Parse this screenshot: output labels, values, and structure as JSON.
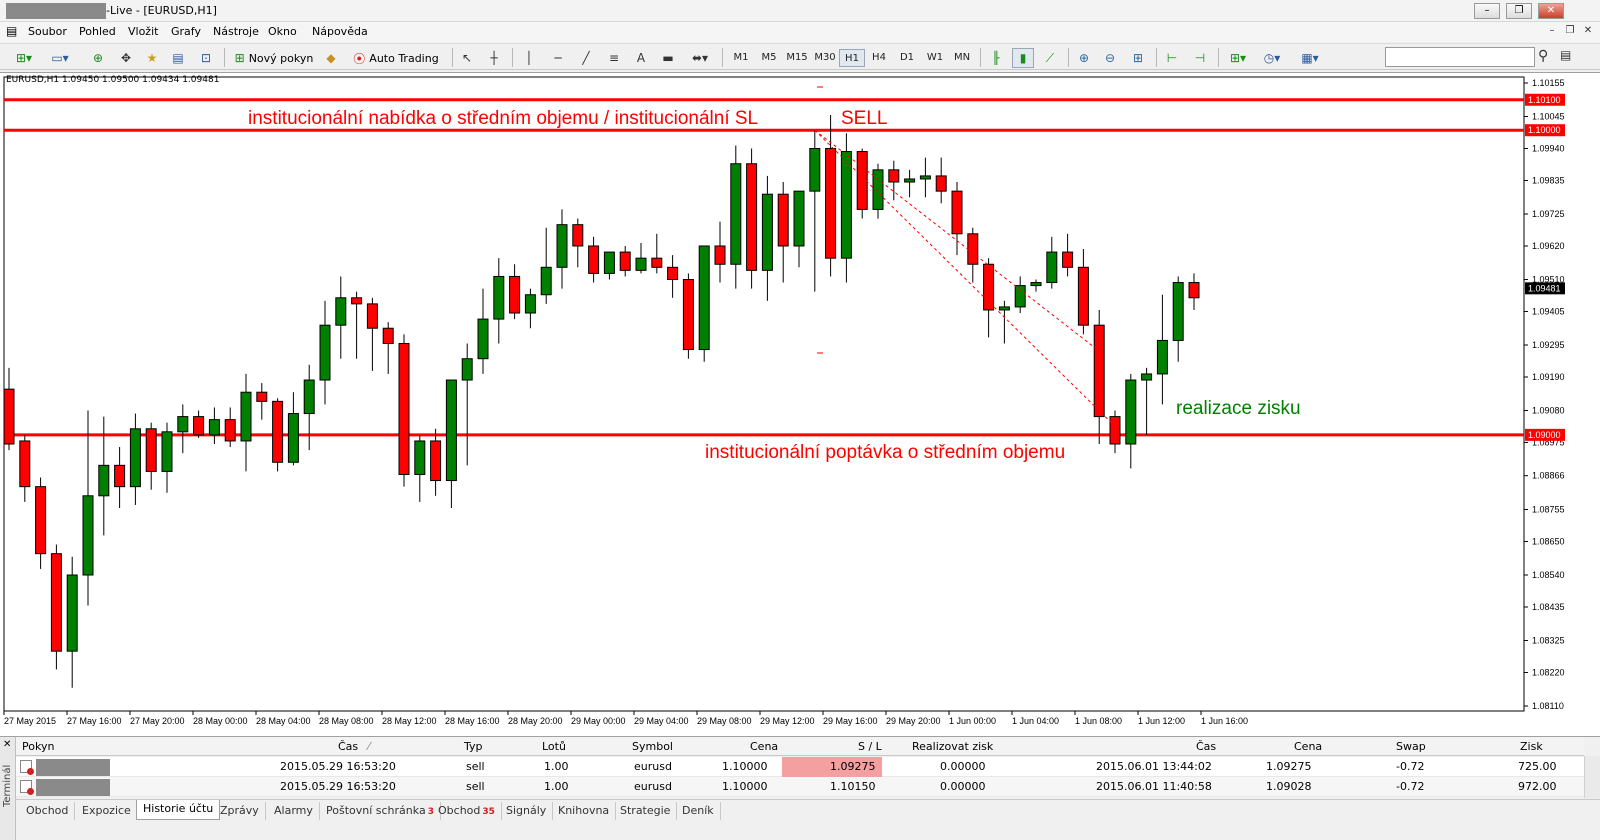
{
  "window": {
    "title": "-Live - [EURUSD,H1]",
    "controls": [
      "–",
      "❐",
      "✕"
    ]
  },
  "menu": {
    "items": [
      "Soubor",
      "Pohled",
      "Vložit",
      "Grafy",
      "Nástroje",
      "Okno",
      "Nápověda"
    ],
    "mdi_controls": [
      "–",
      "❐",
      "✕"
    ]
  },
  "toolbar": {
    "new_order_label": "Nový pokyn",
    "auto_trading_label": "Auto Trading",
    "text_tool_label": "A",
    "timeframes": [
      "M1",
      "M5",
      "M15",
      "M30",
      "H1",
      "H4",
      "D1",
      "W1",
      "MN"
    ],
    "active_timeframe": "H1",
    "search_placeholder": ""
  },
  "chart": {
    "header": "EURUSD,H1  1.09450 1.09500 1.09434 1.09481",
    "price_labels": [
      "1.10155",
      "1.10045",
      "1.09940",
      "1.09835",
      "1.09725",
      "1.09620",
      "1.09510",
      "1.09405",
      "1.09295",
      "1.09190",
      "1.09080",
      "1.08975",
      "1.08866",
      "1.08755",
      "1.08650",
      "1.08540",
      "1.08435",
      "1.08325",
      "1.08220",
      "1.08110"
    ],
    "price_axis_range": [
      1.0811,
      1.10155
    ],
    "line_tags": [
      "1.10100",
      "1.10000",
      "1.09000"
    ],
    "current_price_tag": "1.09481",
    "time_labels": [
      "27 May 2015",
      "27 May 16:00",
      "27 May 20:00",
      "28 May 00:00",
      "28 May 04:00",
      "28 May 08:00",
      "28 May 12:00",
      "28 May 16:00",
      "28 May 20:00",
      "29 May 00:00",
      "29 May 04:00",
      "29 May 08:00",
      "29 May 12:00",
      "29 May 16:00",
      "29 May 20:00",
      "1 Jun 00:00",
      "1 Jun 04:00",
      "1 Jun 08:00",
      "1 Jun 12:00",
      "1 Jun 16:00"
    ],
    "annotations": {
      "supply_zone": "institucionální nabídka o středním objemu / institucionální SL",
      "sell": "SELL",
      "demand_zone": "institucionální poptávka o středním objemu",
      "take_profit": "realizace zisku"
    },
    "colors": {
      "bull": "#008000",
      "bear": "#ff0000",
      "level_line": "#ff0000",
      "text_red": "#ff0000",
      "text_green": "#008000"
    }
  },
  "chart_data": {
    "type": "candlestick",
    "symbol": "EURUSD",
    "timeframe": "H1",
    "ylim": [
      1.0811,
      1.10155
    ],
    "horizontal_levels": [
      1.101,
      1.1,
      1.09
    ],
    "candles": [
      {
        "o": 1.0915,
        "h": 1.0922,
        "l": 1.0895,
        "c": 1.0897
      },
      {
        "o": 1.0898,
        "h": 1.09,
        "l": 1.0878,
        "c": 1.0883
      },
      {
        "o": 1.0883,
        "h": 1.0886,
        "l": 1.0856,
        "c": 1.0861
      },
      {
        "o": 1.0861,
        "h": 1.0864,
        "l": 1.0823,
        "c": 1.0829
      },
      {
        "o": 1.0829,
        "h": 1.086,
        "l": 1.0817,
        "c": 1.0854
      },
      {
        "o": 1.0854,
        "h": 1.0908,
        "l": 1.0844,
        "c": 1.088
      },
      {
        "o": 1.088,
        "h": 1.0906,
        "l": 1.0867,
        "c": 1.089
      },
      {
        "o": 1.089,
        "h": 1.0896,
        "l": 1.0876,
        "c": 1.0883
      },
      {
        "o": 1.0883,
        "h": 1.0907,
        "l": 1.0877,
        "c": 1.0902
      },
      {
        "o": 1.0902,
        "h": 1.0904,
        "l": 1.0882,
        "c": 1.0888
      },
      {
        "o": 1.0888,
        "h": 1.0904,
        "l": 1.0881,
        "c": 1.0901
      },
      {
        "o": 1.0901,
        "h": 1.091,
        "l": 1.0894,
        "c": 1.0906
      },
      {
        "o": 1.0906,
        "h": 1.0908,
        "l": 1.0899,
        "c": 1.09
      },
      {
        "o": 1.09,
        "h": 1.0909,
        "l": 1.0897,
        "c": 1.0905
      },
      {
        "o": 1.0905,
        "h": 1.0909,
        "l": 1.0896,
        "c": 1.0898
      },
      {
        "o": 1.0898,
        "h": 1.092,
        "l": 1.0888,
        "c": 1.0914
      },
      {
        "o": 1.0914,
        "h": 1.0917,
        "l": 1.0905,
        "c": 1.0911
      },
      {
        "o": 1.0911,
        "h": 1.0912,
        "l": 1.0888,
        "c": 1.0891
      },
      {
        "o": 1.0891,
        "h": 1.0914,
        "l": 1.089,
        "c": 1.0907
      },
      {
        "o": 1.0907,
        "h": 1.0923,
        "l": 1.0895,
        "c": 1.0918
      },
      {
        "o": 1.0918,
        "h": 1.0944,
        "l": 1.091,
        "c": 1.0936
      },
      {
        "o": 1.0936,
        "h": 1.0952,
        "l": 1.0925,
        "c": 1.0945
      },
      {
        "o": 1.0945,
        "h": 1.0947,
        "l": 1.0925,
        "c": 1.0943
      },
      {
        "o": 1.0943,
        "h": 1.0945,
        "l": 1.0921,
        "c": 1.0935
      },
      {
        "o": 1.0935,
        "h": 1.0937,
        "l": 1.092,
        "c": 1.093
      },
      {
        "o": 1.093,
        "h": 1.0933,
        "l": 1.0883,
        "c": 1.0887
      },
      {
        "o": 1.0887,
        "h": 1.09,
        "l": 1.0878,
        "c": 1.0898
      },
      {
        "o": 1.0898,
        "h": 1.0902,
        "l": 1.088,
        "c": 1.0885
      },
      {
        "o": 1.0885,
        "h": 1.0915,
        "l": 1.0876,
        "c": 1.0918
      },
      {
        "o": 1.0918,
        "h": 1.093,
        "l": 1.089,
        "c": 1.0925
      },
      {
        "o": 1.0925,
        "h": 1.0948,
        "l": 1.092,
        "c": 1.0938
      },
      {
        "o": 1.0938,
        "h": 1.0958,
        "l": 1.093,
        "c": 1.0952
      },
      {
        "o": 1.0952,
        "h": 1.0956,
        "l": 1.0938,
        "c": 1.094
      },
      {
        "o": 1.094,
        "h": 1.0948,
        "l": 1.0935,
        "c": 1.0946
      },
      {
        "o": 1.0946,
        "h": 1.0968,
        "l": 1.0943,
        "c": 1.0955
      },
      {
        "o": 1.0955,
        "h": 1.0974,
        "l": 1.0948,
        "c": 1.0969
      },
      {
        "o": 1.0969,
        "h": 1.0971,
        "l": 1.0955,
        "c": 1.0962
      },
      {
        "o": 1.0962,
        "h": 1.0965,
        "l": 1.095,
        "c": 1.0953
      },
      {
        "o": 1.0953,
        "h": 1.0958,
        "l": 1.0951,
        "c": 1.096
      },
      {
        "o": 1.096,
        "h": 1.0962,
        "l": 1.0952,
        "c": 1.0954
      },
      {
        "o": 1.0954,
        "h": 1.0963,
        "l": 1.0953,
        "c": 1.0958
      },
      {
        "o": 1.0958,
        "h": 1.0966,
        "l": 1.0953,
        "c": 1.0955
      },
      {
        "o": 1.0955,
        "h": 1.0959,
        "l": 1.0945,
        "c": 1.0951
      },
      {
        "o": 1.0951,
        "h": 1.0953,
        "l": 1.0925,
        "c": 1.0928
      },
      {
        "o": 1.0928,
        "h": 1.0962,
        "l": 1.0924,
        "c": 1.0962
      },
      {
        "o": 1.0962,
        "h": 1.097,
        "l": 1.095,
        "c": 1.0956
      },
      {
        "o": 1.0956,
        "h": 1.0995,
        "l": 1.0948,
        "c": 1.0989
      },
      {
        "o": 1.0989,
        "h": 1.0994,
        "l": 1.0948,
        "c": 1.0954
      },
      {
        "o": 1.0954,
        "h": 1.0985,
        "l": 1.0944,
        "c": 1.0979
      },
      {
        "o": 1.0979,
        "h": 1.0983,
        "l": 1.095,
        "c": 1.0962
      },
      {
        "o": 1.0962,
        "h": 1.098,
        "l": 1.0955,
        "c": 1.098
      },
      {
        "o": 1.098,
        "h": 1.1,
        "l": 1.0947,
        "c": 1.0994
      },
      {
        "o": 1.0994,
        "h": 1.1005,
        "l": 1.0952,
        "c": 1.0958
      },
      {
        "o": 1.0958,
        "h": 1.0999,
        "l": 1.095,
        "c": 1.0993
      },
      {
        "o": 1.0993,
        "h": 1.0994,
        "l": 1.0971,
        "c": 1.0974
      },
      {
        "o": 1.0974,
        "h": 1.0989,
        "l": 1.0971,
        "c": 1.0987
      },
      {
        "o": 1.0987,
        "h": 1.099,
        "l": 1.0977,
        "c": 1.0983
      },
      {
        "o": 1.0983,
        "h": 1.0987,
        "l": 1.0978,
        "c": 1.0984
      },
      {
        "o": 1.0984,
        "h": 1.0991,
        "l": 1.0978,
        "c": 1.0985
      },
      {
        "o": 1.0985,
        "h": 1.0991,
        "l": 1.0976,
        "c": 1.098
      },
      {
        "o": 1.098,
        "h": 1.0983,
        "l": 1.0959,
        "c": 1.0966
      },
      {
        "o": 1.0966,
        "h": 1.0968,
        "l": 1.095,
        "c": 1.0956
      },
      {
        "o": 1.0956,
        "h": 1.0958,
        "l": 1.0932,
        "c": 1.0941
      },
      {
        "o": 1.0941,
        "h": 1.0944,
        "l": 1.093,
        "c": 1.0942
      },
      {
        "o": 1.0942,
        "h": 1.0952,
        "l": 1.094,
        "c": 1.0949
      },
      {
        "o": 1.0949,
        "h": 1.0951,
        "l": 1.0947,
        "c": 1.095
      },
      {
        "o": 1.095,
        "h": 1.0965,
        "l": 1.0948,
        "c": 1.096
      },
      {
        "o": 1.096,
        "h": 1.0966,
        "l": 1.0952,
        "c": 1.0955
      },
      {
        "o": 1.0955,
        "h": 1.0961,
        "l": 1.0933,
        "c": 1.0936
      },
      {
        "o": 1.0936,
        "h": 1.0941,
        "l": 1.0897,
        "c": 1.0906
      },
      {
        "o": 1.0906,
        "h": 1.0908,
        "l": 1.0894,
        "c": 1.0897
      },
      {
        "o": 1.0897,
        "h": 1.092,
        "l": 1.0889,
        "c": 1.0918
      },
      {
        "o": 1.0918,
        "h": 1.0922,
        "l": 1.09,
        "c": 1.092
      },
      {
        "o": 1.092,
        "h": 1.0946,
        "l": 1.091,
        "c": 1.0931
      },
      {
        "o": 1.0931,
        "h": 1.0952,
        "l": 1.0924,
        "c": 1.095
      },
      {
        "o": 1.095,
        "h": 1.0953,
        "l": 1.0941,
        "c": 1.0945
      }
    ]
  },
  "terminal": {
    "side_label": "Terminál",
    "columns": [
      "Pokyn",
      "Čas",
      "Typ",
      "Lotů",
      "Symbol",
      "Cena",
      "S / L",
      "Realizovat zisk",
      "Čas",
      "Cena",
      "Swap",
      "Zisk"
    ],
    "rows": [
      {
        "open_time": "2015.05.29 16:53:20",
        "type": "sell",
        "lots": "1.00",
        "symbol": "eurusd",
        "open_price": "1.10000",
        "sl": "1.09275",
        "tp": "0.00000",
        "close_time": "2015.06.01 13:44:02",
        "close_price": "1.09275",
        "swap": "-0.72",
        "profit": "725.00"
      },
      {
        "open_time": "2015.05.29 16:53:20",
        "type": "sell",
        "lots": "1.00",
        "symbol": "eurusd",
        "open_price": "1.10000",
        "sl": "1.10150",
        "tp": "0.00000",
        "close_time": "2015.06.01 11:40:58",
        "close_price": "1.09028",
        "swap": "-0.72",
        "profit": "972.00"
      }
    ],
    "tabs": [
      {
        "label": "Obchod",
        "badge": ""
      },
      {
        "label": "Expozice",
        "badge": ""
      },
      {
        "label": "Historie účtu",
        "badge": ""
      },
      {
        "label": "Zprávy",
        "badge": ""
      },
      {
        "label": "Alarmy",
        "badge": ""
      },
      {
        "label": "Poštovní schránka",
        "badge": "3"
      },
      {
        "label": "Obchod",
        "badge": "35"
      },
      {
        "label": "Signály",
        "badge": ""
      },
      {
        "label": "Knihovna",
        "badge": ""
      },
      {
        "label": "Strategie",
        "badge": ""
      },
      {
        "label": "Deník",
        "badge": ""
      }
    ],
    "active_tab": "Historie účtu"
  }
}
